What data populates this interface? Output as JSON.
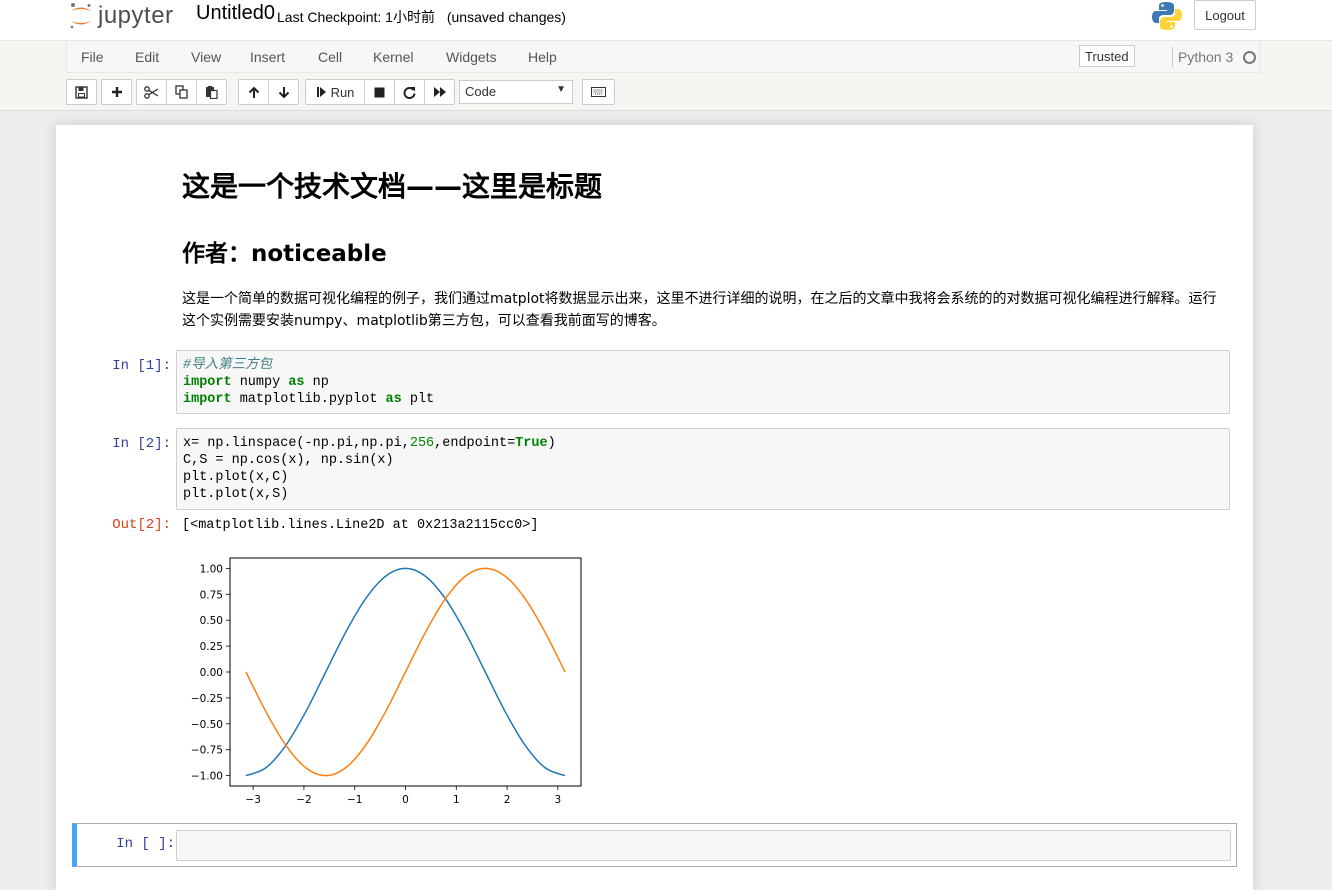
{
  "header": {
    "brand": "jupyter",
    "notebook_name": "Untitled0",
    "checkpoint": "Last Checkpoint: 1小时前",
    "unsaved": "(unsaved changes)",
    "logout_label": "Logout"
  },
  "menubar": {
    "items": [
      "File",
      "Edit",
      "View",
      "Insert",
      "Cell",
      "Kernel",
      "Widgets",
      "Help"
    ],
    "trusted": "Trusted",
    "kernel": "Python 3"
  },
  "toolbar": {
    "run_label": "Run",
    "cell_type": "Code"
  },
  "notebook": {
    "title": "这是一个技术文档——这里是标题",
    "author": "作者：noticeable",
    "paragraph": "这是一个简单的数据可视化编程的例子，我们通过matplot将数据显示出来，这里不进行详细的说明，在之后的文章中我将会系统的的对数据可视化编程进行解释。运行这个实例需要安装numpy、matplotlib第三方包，可以查看我前面写的博客。",
    "cells": [
      {
        "prompt": "In [1]:",
        "lines": [
          "#导入第三方包",
          "import numpy as np",
          "import matplotlib.pyplot as plt"
        ]
      },
      {
        "prompt": "In [2]:",
        "lines": [
          "x= np.linspace(-np.pi,np.pi,256,endpoint=True)",
          "C,S = np.cos(x), np.sin(x)",
          "plt.plot(x,C)",
          "plt.plot(x,S)"
        ]
      }
    ],
    "output_prompt": "Out[2]:",
    "output_text": "[<matplotlib.lines.Line2D at 0x213a2115cc0>]",
    "empty_prompt": "In [ ]:"
  },
  "chart_data": {
    "type": "line",
    "x": [
      -3.1416,
      -2.7489,
      -2.3562,
      -1.9635,
      -1.5708,
      -1.1781,
      -0.7854,
      -0.3927,
      0.0,
      0.3927,
      0.7854,
      1.1781,
      1.5708,
      1.9635,
      2.3562,
      2.7489,
      3.1416
    ],
    "series": [
      {
        "values": [
          -1.0,
          -0.924,
          -0.707,
          -0.383,
          0.0,
          0.383,
          0.707,
          0.924,
          1.0,
          0.924,
          0.707,
          0.383,
          0.0,
          -0.383,
          -0.707,
          -0.924,
          -1.0
        ],
        "color": "#1f77b4"
      },
      {
        "values": [
          0.0,
          -0.383,
          -0.707,
          -0.924,
          -1.0,
          -0.924,
          -0.707,
          -0.383,
          0.0,
          0.383,
          0.707,
          0.924,
          1.0,
          0.924,
          0.707,
          0.383,
          0.0
        ],
        "color": "#ff7f0e"
      }
    ],
    "xticks": [
      "−3",
      "−2",
      "−1",
      "0",
      "1",
      "2",
      "3"
    ],
    "yticks": [
      "1.00",
      "0.75",
      "0.50",
      "0.25",
      "0.00",
      "−0.25",
      "−0.50",
      "−0.75",
      "−1.00"
    ],
    "xlim": [
      -3.4558,
      3.4558
    ],
    "ylim": [
      -1.1,
      1.1
    ],
    "title": "",
    "xlabel": "",
    "ylabel": "",
    "grid": false
  }
}
